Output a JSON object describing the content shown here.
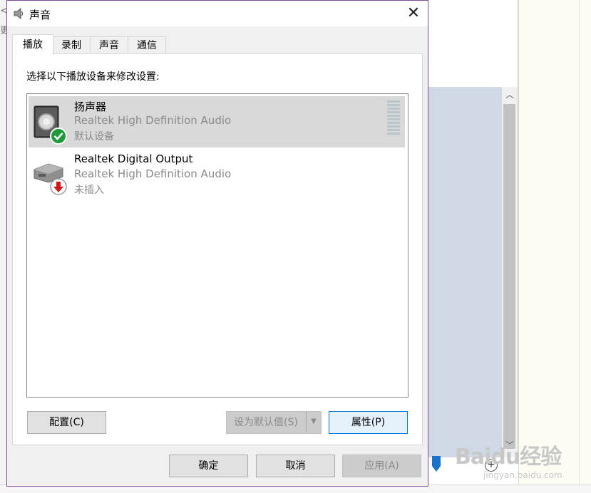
{
  "window": {
    "title": "声音"
  },
  "tabs": [
    {
      "label": "播放",
      "active": true
    },
    {
      "label": "录制",
      "active": false
    },
    {
      "label": "声音",
      "active": false
    },
    {
      "label": "通信",
      "active": false
    }
  ],
  "playback": {
    "instruction": "选择以下播放设备来修改设置:",
    "devices": [
      {
        "name": "扬声器",
        "description": "Realtek High Definition Audio",
        "status": "默认设备",
        "icon": "speaker-icon",
        "badge": "default-check-icon",
        "selected": true
      },
      {
        "name": "Realtek Digital Output",
        "description": "Realtek High Definition Audio",
        "status": "未插入",
        "icon": "digital-output-icon",
        "badge": "unplugged-arrow-icon",
        "selected": false
      }
    ],
    "configure_label": "配置(C)",
    "set_default_label": "设为默认值(S)",
    "properties_label": "属性(P)"
  },
  "footer": {
    "ok_label": "确定",
    "cancel_label": "取消",
    "apply_label": "应用(A)"
  },
  "background": {
    "left_glyphs": [
      "<",
      "更"
    ],
    "watermark": "Baidu经验",
    "watermark_sub": "jingyan.baidu.com"
  },
  "colors": {
    "dialog_border": "#7a4c9a",
    "selection": "#d9d9d9",
    "primary_button_border": "#0078d7",
    "check_badge": "#1f9a3a",
    "unplugged_badge": "#d01818"
  }
}
